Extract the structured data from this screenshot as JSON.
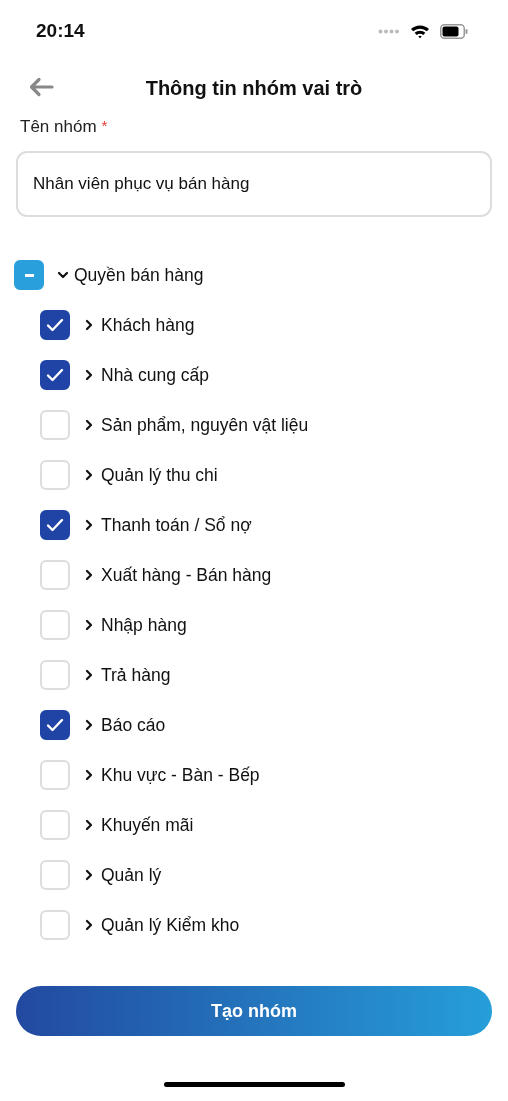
{
  "status_bar": {
    "time": "20:14"
  },
  "header": {
    "title": "Thông tin nhóm vai trò"
  },
  "group_name": {
    "label": "Tên nhóm",
    "required_mark": "*",
    "value": "Nhân viên phục vụ bán hàng"
  },
  "permissions": {
    "label": "Quyền bán hàng",
    "indeterminate": true,
    "expanded": true,
    "children": [
      {
        "label": "Khách hàng",
        "checked": true,
        "expanded": false
      },
      {
        "label": "Nhà cung cấp",
        "checked": true,
        "expanded": false
      },
      {
        "label": "Sản phẩm, nguyên vật liệu",
        "checked": false,
        "expanded": false
      },
      {
        "label": "Quản lý thu chi",
        "checked": false,
        "expanded": false
      },
      {
        "label": "Thanh toán / Sổ nợ",
        "checked": true,
        "expanded": false
      },
      {
        "label": "Xuất hàng - Bán hàng",
        "checked": false,
        "expanded": false
      },
      {
        "label": "Nhập hàng",
        "checked": false,
        "expanded": false
      },
      {
        "label": "Trả hàng",
        "checked": false,
        "expanded": false
      },
      {
        "label": "Báo cáo",
        "checked": true,
        "expanded": false
      },
      {
        "label": "Khu vực - Bàn - Bếp",
        "checked": false,
        "expanded": false
      },
      {
        "label": "Khuyến mãi",
        "checked": false,
        "expanded": false
      },
      {
        "label": "Quản lý",
        "checked": false,
        "expanded": false
      },
      {
        "label": "Quản lý Kiểm kho",
        "checked": false,
        "expanded": false
      }
    ]
  },
  "submit_button": {
    "label": "Tạo nhóm"
  }
}
